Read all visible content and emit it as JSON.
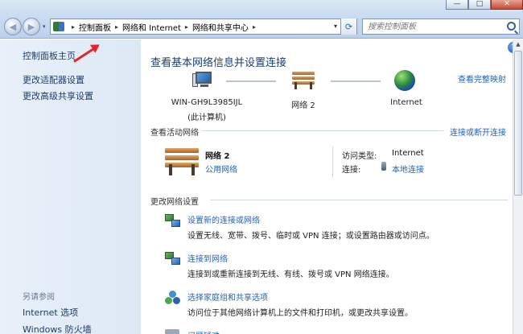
{
  "window": {
    "caption_buttons": [
      "—",
      "□",
      "✕"
    ]
  },
  "nav": {
    "back_glyph": "◀",
    "forward_glyph": "▶",
    "dropdown_glyph": "▾"
  },
  "address": {
    "breadcrumb": [
      "控制面板",
      "网络和 Internet",
      "网络和共享中心"
    ],
    "separator": "▸",
    "dropdown_glyph": "▾",
    "refresh_glyph": "⟳"
  },
  "search": {
    "placeholder": "搜索控制面板"
  },
  "sidebar": {
    "home": "控制面板主页",
    "adapter": "更改适配器设置",
    "advanced": "更改高级共享设置",
    "see_also": "另请参阅",
    "links": [
      "Internet 选项",
      "Windows 防火墙"
    ]
  },
  "main": {
    "help_glyph": "?",
    "title": "查看基本网络信息并设置连接",
    "full_map_link": "查看完整映射",
    "map": {
      "computer_name": "WIN-GH9L3985IJL",
      "computer_sub": "(此计算机)",
      "network": "网络  2",
      "internet": "Internet"
    },
    "active_section": {
      "title": "查看活动网络",
      "connect_link": "连接或断开连接",
      "network_name": "网络  2",
      "network_type": "公用网络",
      "access_type_label": "访问类型:",
      "access_type_value": "Internet",
      "connections_label": "连接:",
      "connections_value": "本地连接"
    },
    "change_section": {
      "title": "更改网络设置",
      "tasks": [
        {
          "link": "设置新的连接或网络",
          "desc": "设置无线、宽带、拨号、临时或 VPN 连接；或设置路由器或访问点。"
        },
        {
          "link": "连接到网络",
          "desc": "连接到或重新连接到无线、有线、拨号或 VPN 网络连接。"
        },
        {
          "link": "选择家庭组和共享选项",
          "desc": "访问位于其他网络计算机上的文件和打印机，或更改共享设置。"
        },
        {
          "link": "问题疑难",
          "desc": ""
        }
      ]
    }
  },
  "scrollbar": {
    "up_glyph": "▲"
  },
  "colors": {
    "link": "#1f62b6",
    "title": "#1e3f6f",
    "sidebar_bg": "#e3ecf7",
    "annotation_arrow": "#e4242b"
  }
}
